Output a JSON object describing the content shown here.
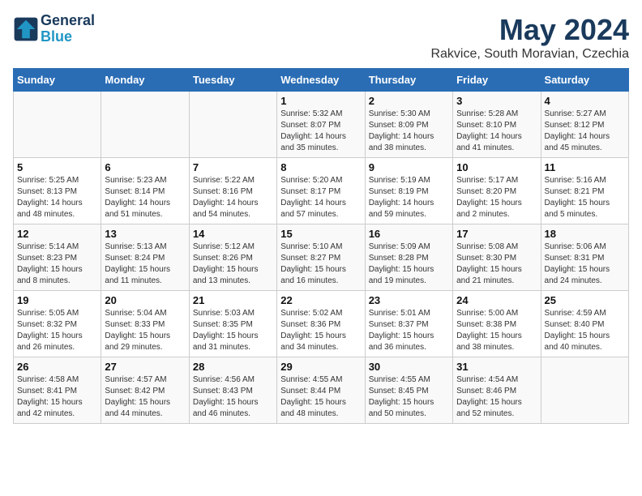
{
  "header": {
    "logo_line1": "General",
    "logo_line2": "Blue",
    "title": "May 2024",
    "subtitle": "Rakvice, South Moravian, Czechia"
  },
  "weekdays": [
    "Sunday",
    "Monday",
    "Tuesday",
    "Wednesday",
    "Thursday",
    "Friday",
    "Saturday"
  ],
  "weeks": [
    [
      {
        "day": "",
        "sunrise": "",
        "sunset": "",
        "daylight": "",
        "empty": true
      },
      {
        "day": "",
        "sunrise": "",
        "sunset": "",
        "daylight": "",
        "empty": true
      },
      {
        "day": "",
        "sunrise": "",
        "sunset": "",
        "daylight": "",
        "empty": true
      },
      {
        "day": "1",
        "sunrise": "Sunrise: 5:32 AM",
        "sunset": "Sunset: 8:07 PM",
        "daylight": "Daylight: 14 hours and 35 minutes."
      },
      {
        "day": "2",
        "sunrise": "Sunrise: 5:30 AM",
        "sunset": "Sunset: 8:09 PM",
        "daylight": "Daylight: 14 hours and 38 minutes."
      },
      {
        "day": "3",
        "sunrise": "Sunrise: 5:28 AM",
        "sunset": "Sunset: 8:10 PM",
        "daylight": "Daylight: 14 hours and 41 minutes."
      },
      {
        "day": "4",
        "sunrise": "Sunrise: 5:27 AM",
        "sunset": "Sunset: 8:12 PM",
        "daylight": "Daylight: 14 hours and 45 minutes."
      }
    ],
    [
      {
        "day": "5",
        "sunrise": "Sunrise: 5:25 AM",
        "sunset": "Sunset: 8:13 PM",
        "daylight": "Daylight: 14 hours and 48 minutes."
      },
      {
        "day": "6",
        "sunrise": "Sunrise: 5:23 AM",
        "sunset": "Sunset: 8:14 PM",
        "daylight": "Daylight: 14 hours and 51 minutes."
      },
      {
        "day": "7",
        "sunrise": "Sunrise: 5:22 AM",
        "sunset": "Sunset: 8:16 PM",
        "daylight": "Daylight: 14 hours and 54 minutes."
      },
      {
        "day": "8",
        "sunrise": "Sunrise: 5:20 AM",
        "sunset": "Sunset: 8:17 PM",
        "daylight": "Daylight: 14 hours and 57 minutes."
      },
      {
        "day": "9",
        "sunrise": "Sunrise: 5:19 AM",
        "sunset": "Sunset: 8:19 PM",
        "daylight": "Daylight: 14 hours and 59 minutes."
      },
      {
        "day": "10",
        "sunrise": "Sunrise: 5:17 AM",
        "sunset": "Sunset: 8:20 PM",
        "daylight": "Daylight: 15 hours and 2 minutes."
      },
      {
        "day": "11",
        "sunrise": "Sunrise: 5:16 AM",
        "sunset": "Sunset: 8:21 PM",
        "daylight": "Daylight: 15 hours and 5 minutes."
      }
    ],
    [
      {
        "day": "12",
        "sunrise": "Sunrise: 5:14 AM",
        "sunset": "Sunset: 8:23 PM",
        "daylight": "Daylight: 15 hours and 8 minutes."
      },
      {
        "day": "13",
        "sunrise": "Sunrise: 5:13 AM",
        "sunset": "Sunset: 8:24 PM",
        "daylight": "Daylight: 15 hours and 11 minutes."
      },
      {
        "day": "14",
        "sunrise": "Sunrise: 5:12 AM",
        "sunset": "Sunset: 8:26 PM",
        "daylight": "Daylight: 15 hours and 13 minutes."
      },
      {
        "day": "15",
        "sunrise": "Sunrise: 5:10 AM",
        "sunset": "Sunset: 8:27 PM",
        "daylight": "Daylight: 15 hours and 16 minutes."
      },
      {
        "day": "16",
        "sunrise": "Sunrise: 5:09 AM",
        "sunset": "Sunset: 8:28 PM",
        "daylight": "Daylight: 15 hours and 19 minutes."
      },
      {
        "day": "17",
        "sunrise": "Sunrise: 5:08 AM",
        "sunset": "Sunset: 8:30 PM",
        "daylight": "Daylight: 15 hours and 21 minutes."
      },
      {
        "day": "18",
        "sunrise": "Sunrise: 5:06 AM",
        "sunset": "Sunset: 8:31 PM",
        "daylight": "Daylight: 15 hours and 24 minutes."
      }
    ],
    [
      {
        "day": "19",
        "sunrise": "Sunrise: 5:05 AM",
        "sunset": "Sunset: 8:32 PM",
        "daylight": "Daylight: 15 hours and 26 minutes."
      },
      {
        "day": "20",
        "sunrise": "Sunrise: 5:04 AM",
        "sunset": "Sunset: 8:33 PM",
        "daylight": "Daylight: 15 hours and 29 minutes."
      },
      {
        "day": "21",
        "sunrise": "Sunrise: 5:03 AM",
        "sunset": "Sunset: 8:35 PM",
        "daylight": "Daylight: 15 hours and 31 minutes."
      },
      {
        "day": "22",
        "sunrise": "Sunrise: 5:02 AM",
        "sunset": "Sunset: 8:36 PM",
        "daylight": "Daylight: 15 hours and 34 minutes."
      },
      {
        "day": "23",
        "sunrise": "Sunrise: 5:01 AM",
        "sunset": "Sunset: 8:37 PM",
        "daylight": "Daylight: 15 hours and 36 minutes."
      },
      {
        "day": "24",
        "sunrise": "Sunrise: 5:00 AM",
        "sunset": "Sunset: 8:38 PM",
        "daylight": "Daylight: 15 hours and 38 minutes."
      },
      {
        "day": "25",
        "sunrise": "Sunrise: 4:59 AM",
        "sunset": "Sunset: 8:40 PM",
        "daylight": "Daylight: 15 hours and 40 minutes."
      }
    ],
    [
      {
        "day": "26",
        "sunrise": "Sunrise: 4:58 AM",
        "sunset": "Sunset: 8:41 PM",
        "daylight": "Daylight: 15 hours and 42 minutes."
      },
      {
        "day": "27",
        "sunrise": "Sunrise: 4:57 AM",
        "sunset": "Sunset: 8:42 PM",
        "daylight": "Daylight: 15 hours and 44 minutes."
      },
      {
        "day": "28",
        "sunrise": "Sunrise: 4:56 AM",
        "sunset": "Sunset: 8:43 PM",
        "daylight": "Daylight: 15 hours and 46 minutes."
      },
      {
        "day": "29",
        "sunrise": "Sunrise: 4:55 AM",
        "sunset": "Sunset: 8:44 PM",
        "daylight": "Daylight: 15 hours and 48 minutes."
      },
      {
        "day": "30",
        "sunrise": "Sunrise: 4:55 AM",
        "sunset": "Sunset: 8:45 PM",
        "daylight": "Daylight: 15 hours and 50 minutes."
      },
      {
        "day": "31",
        "sunrise": "Sunrise: 4:54 AM",
        "sunset": "Sunset: 8:46 PM",
        "daylight": "Daylight: 15 hours and 52 minutes."
      },
      {
        "day": "",
        "sunrise": "",
        "sunset": "",
        "daylight": "",
        "empty": true
      }
    ]
  ]
}
